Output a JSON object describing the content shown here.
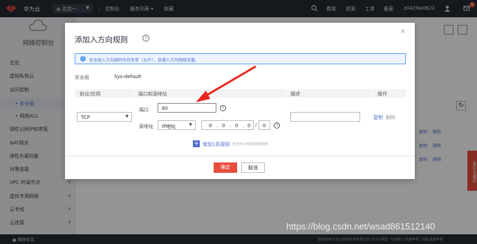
{
  "topbar": {
    "brand": "华为云",
    "region": "北京一",
    "nav": [
      "控制台",
      "服务列表 ▾",
      "收藏"
    ],
    "right": [
      "费用",
      "资源",
      "工单",
      "备案",
      "z0429w0622"
    ],
    "badge": "8"
  },
  "sidebar": {
    "title": "网络控制台",
    "items": [
      {
        "label": "总览"
      },
      {
        "label": "虚拟私有云"
      },
      {
        "label": "访问控制"
      },
      {
        "label": "安全组"
      },
      {
        "label": "网络ACL"
      },
      {
        "label": "弹性公网IP和带宽"
      },
      {
        "label": "NAT网关"
      },
      {
        "label": "弹性负载均衡"
      },
      {
        "label": "对等连接"
      },
      {
        "label": "VPC 终端节点"
      },
      {
        "label": "虚拟专用网络"
      },
      {
        "label": "云专线"
      },
      {
        "label": "云连接"
      }
    ]
  },
  "background": {
    "row_links": [
      "复制",
      "删除"
    ],
    "feedback": "意见与建议"
  },
  "dialog": {
    "title": "添加入方向规则",
    "notice": "安全组入方向规则为白名单（允许），放通入方向网络流量。",
    "sg_label": "安全组",
    "sg_value": "Sys-default",
    "headers": [
      "协议/应用",
      "端口和源地址",
      "描述",
      "操作"
    ],
    "protocol": "TCP",
    "port_label": "端口",
    "port_value": "80",
    "source_label": "源地址",
    "source_type": "IP地址",
    "ip": [
      "0",
      "0",
      "0",
      "0"
    ],
    "mask": "0",
    "actions": [
      "复制",
      "删除"
    ],
    "add_rule": "增加1条规则",
    "add_hint": "您还可以增加99条规则",
    "confirm": "确定",
    "cancel": "取消"
  },
  "bottombar": {
    "lang": "简体中文",
    "copyright": "版权所有©华为软件技术有限公司 2019 保留一切权利  |  法律声明  |  隐私政策声明"
  },
  "watermark": "https://blog.csdn.net/wsad861512140",
  "colors": {
    "accent_red": "#e84c3d",
    "link_blue": "#526ecc",
    "arrow_red": "#e8281e"
  }
}
